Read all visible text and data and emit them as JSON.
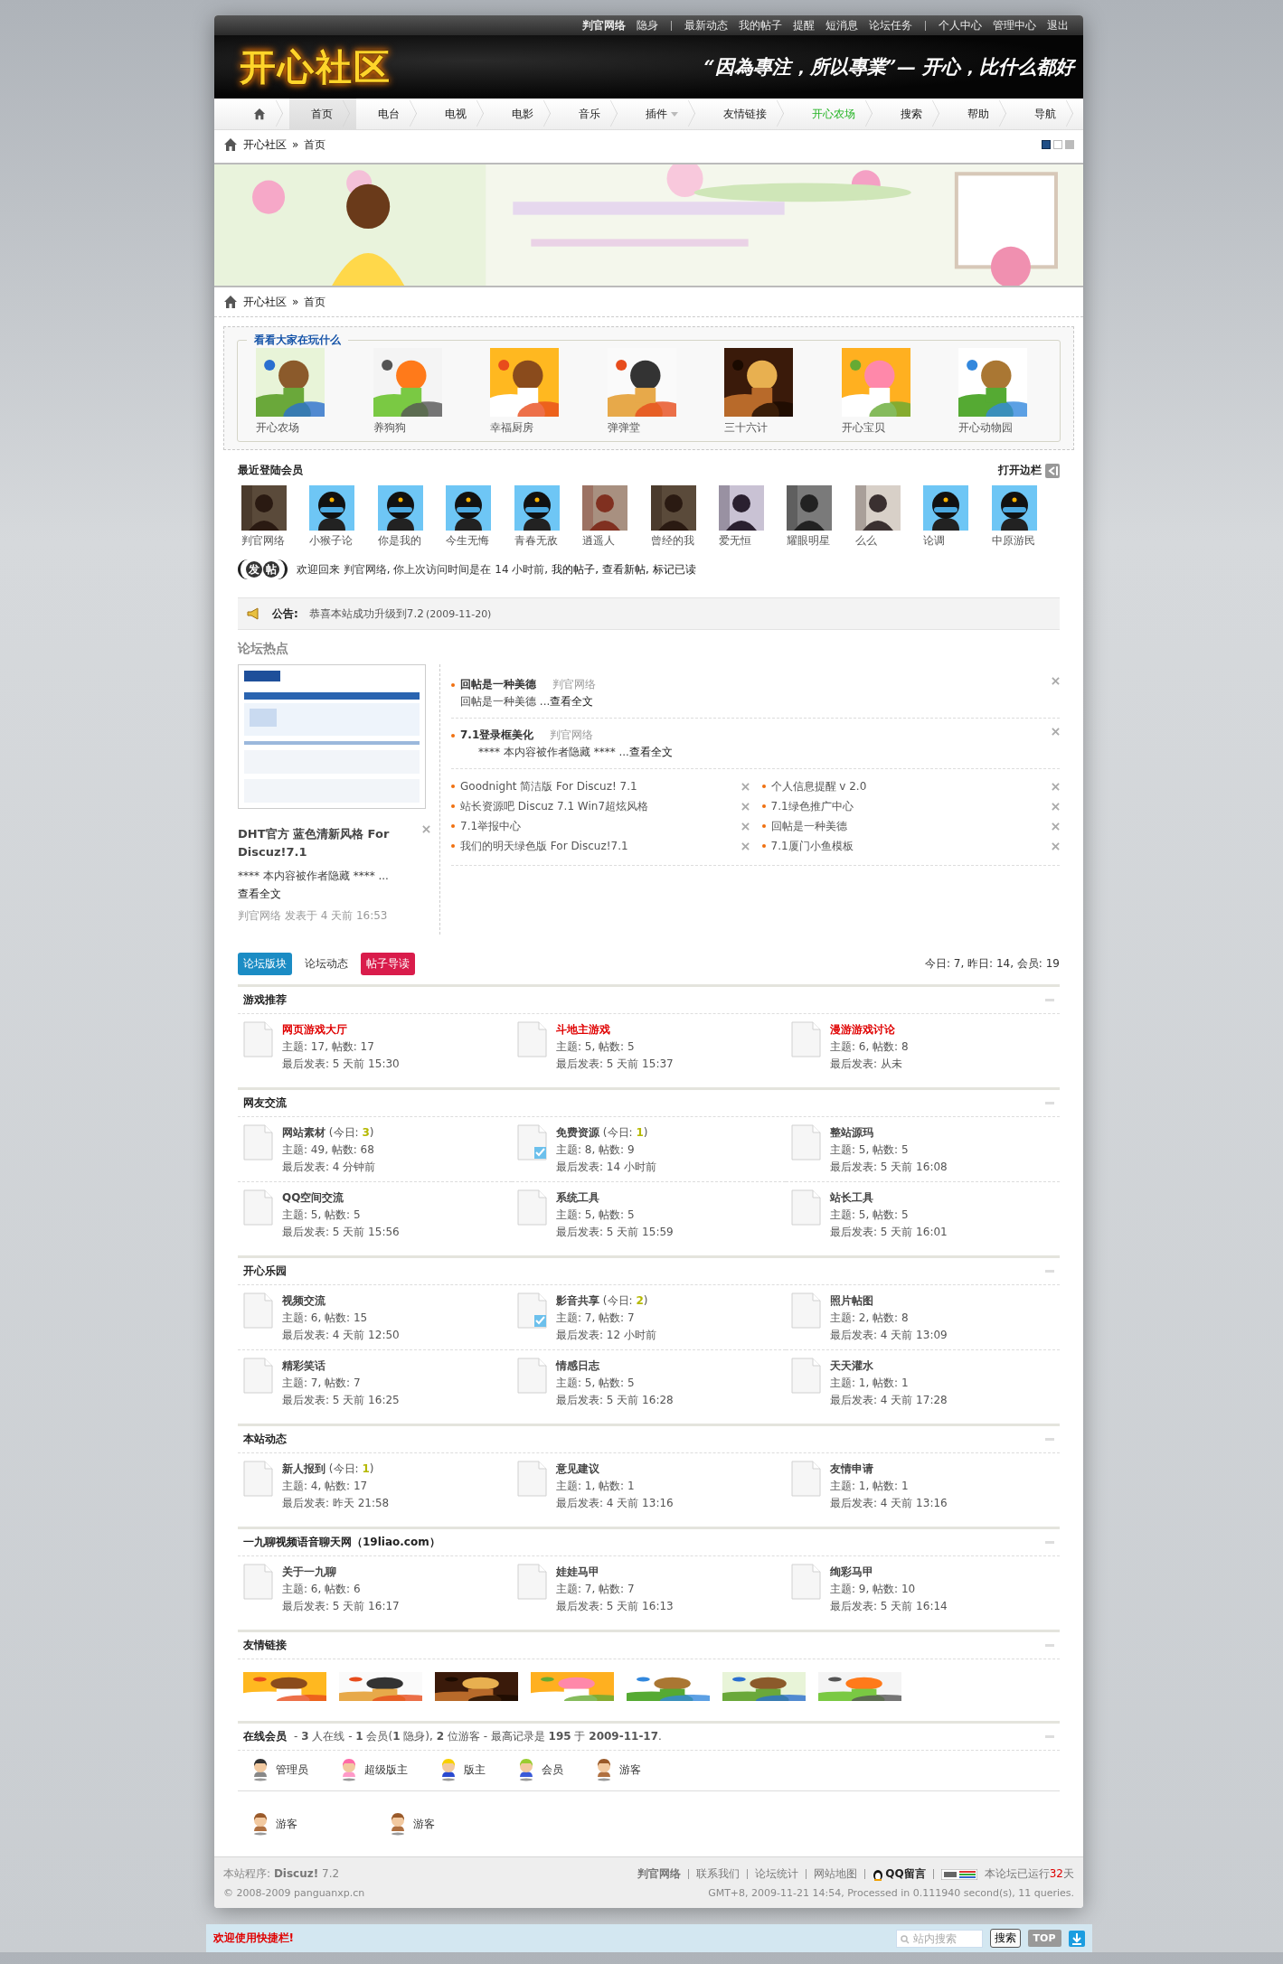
{
  "top_bar": {
    "user": "判官网络",
    "link_groups": [
      [
        "隐身"
      ],
      [
        "最新动态",
        "我的帖子",
        "提醒",
        "短消息",
        "论坛任务"
      ],
      [
        "个人中心",
        "管理中心",
        "退出"
      ]
    ]
  },
  "header": {
    "logo": "开心社区",
    "slogan": "“因為專注，所以專業”— 开心，比什么都好"
  },
  "nav": [
    {
      "label": "首页",
      "selected": true,
      "dropdown": false,
      "highlighted": false
    },
    {
      "label": "电台",
      "selected": false,
      "dropdown": false,
      "highlighted": false
    },
    {
      "label": "电视",
      "selected": false,
      "dropdown": false,
      "highlighted": false
    },
    {
      "label": "电影",
      "selected": false,
      "dropdown": false,
      "highlighted": false
    },
    {
      "label": "音乐",
      "selected": false,
      "dropdown": false,
      "highlighted": false
    },
    {
      "label": "插件",
      "selected": false,
      "dropdown": true,
      "highlighted": false
    },
    {
      "label": "友情链接",
      "selected": false,
      "dropdown": false,
      "highlighted": false
    },
    {
      "label": "开心农场",
      "selected": false,
      "dropdown": false,
      "highlighted": true
    },
    {
      "label": "搜索",
      "selected": false,
      "dropdown": false,
      "highlighted": false
    },
    {
      "label": "帮助",
      "selected": false,
      "dropdown": false,
      "highlighted": false
    },
    {
      "label": "导航",
      "selected": false,
      "dropdown": false,
      "highlighted": false
    }
  ],
  "breadcrumb": {
    "root": "开心社区",
    "separator": "»",
    "current": "首页"
  },
  "style_swatches": [
    {
      "color": "#1f4e86",
      "selected": true
    },
    {
      "color": "#ffffff",
      "selected": false
    },
    {
      "color": "#bbbbbb",
      "selected": false
    }
  ],
  "breadcrumb_2": {
    "root": "开心社区",
    "separator": "»",
    "current": "首页"
  },
  "games": {
    "title": "看看大家在玩什么",
    "items": [
      "开心农场",
      "养狗狗",
      "幸福厨房",
      "弹弹堂",
      "三十六计",
      "开心宝贝",
      "开心动物园"
    ]
  },
  "members": {
    "title": "最近登陆会员",
    "sidebar_toggle": "打开边栏",
    "items": [
      {
        "name": "判官网络"
      },
      {
        "name": "小猴子论",
        "kind": "default"
      },
      {
        "name": "你是我的",
        "kind": "default"
      },
      {
        "name": "今生无悔",
        "kind": "default"
      },
      {
        "name": "青春无敌",
        "kind": "default"
      },
      {
        "name": "逍遥人"
      },
      {
        "name": "曾经的我"
      },
      {
        "name": "爱无恒"
      },
      {
        "name": "耀眼明星"
      },
      {
        "name": "么么"
      },
      {
        "name": "论调",
        "kind": "default"
      },
      {
        "name": "中原游民",
        "kind": "default"
      }
    ]
  },
  "welcome": {
    "post_button": "发帖",
    "text": "欢迎回来  判官网络, 你上次访问时间是在  14 小时前,",
    "links": [
      "我的帖子,",
      "查看新帖,",
      "标记已读"
    ]
  },
  "announcement": {
    "label": "公告:",
    "text": "恭喜本站成功升级到7.2",
    "date": "(2009-11-20)"
  },
  "hot": {
    "title": "论坛热点",
    "feature": {
      "title": "DHT官方  蓝色清新风格  For Discuz!7.1",
      "excerpt": "**** 本内容被作者隐藏 **** ...",
      "more": "查看全文",
      "meta": "判官网络  发表于  4 天前 16:53"
    },
    "posts": [
      {
        "title": "回帖是一种美德",
        "author": "判官网络",
        "excerpt": "回帖是一种美德  ...",
        "more": "查看全文"
      },
      {
        "title": "7.1登录框美化",
        "author": "判官网络",
        "excerpt": "**** 本内容被作者隐藏 **** ...",
        "more": "查看全文"
      }
    ],
    "link_columns": [
      [
        "Goodnight 简洁版  For Discuz! 7.1",
        "站长资源吧  Discuz 7.1 Win7超炫风格",
        "7.1举报中心",
        "我们的明天绿色版  For Discuz!7.1"
      ],
      [
        "个人信息提醒  v 2.0",
        "7.1绿色推广中心",
        "回帖是一种美德",
        "7.1厦门小鱼模板"
      ]
    ]
  },
  "tabs": [
    {
      "label": "论坛版块",
      "color": "#1b8cc4"
    },
    {
      "label": "论坛动态"
    },
    {
      "label": "帖子导读",
      "color": "#d91c4b"
    }
  ],
  "stats": "今日: 7, 昨日: 14, 会员: 19",
  "sections": [
    {
      "title": "游戏推荐",
      "forums": [
        {
          "name": "网页游戏大厅",
          "highlighted": true,
          "has_new": false,
          "stats": "主题: 17, 帖数: 17",
          "last": "最后发表: 5 天前 15:30"
        },
        {
          "name": "斗地主游戏",
          "highlighted": true,
          "has_new": false,
          "stats": "主题: 5, 帖数: 5",
          "last": "最后发表: 5 天前 15:37"
        },
        {
          "name": "漫游游戏讨论",
          "highlighted": true,
          "has_new": false,
          "stats": "主题: 6, 帖数: 8",
          "last": "最后发表: 从未"
        }
      ]
    },
    {
      "title": "网友交流",
      "forums": [
        {
          "name": "网站素材",
          "highlighted": false,
          "has_new": false,
          "today": {
            "prefix": "(今日:",
            "count": "3",
            "suffix": ")"
          },
          "stats": "主题: 49, 帖数: 68",
          "last": "最后发表: 4 分钟前"
        },
        {
          "name": "免费资源",
          "highlighted": false,
          "has_new": true,
          "today": {
            "prefix": "(今日:",
            "count": "1",
            "suffix": ")"
          },
          "stats": "主题: 8, 帖数: 9",
          "last": "最后发表: 14 小时前"
        },
        {
          "name": "整站源玛",
          "highlighted": false,
          "has_new": false,
          "stats": "主题: 5, 帖数: 5",
          "last": "最后发表: 5 天前 16:08"
        },
        {
          "name": "QQ空间交流",
          "highlighted": false,
          "has_new": false,
          "stats": "主题: 5, 帖数: 5",
          "last": "最后发表: 5 天前 15:56"
        },
        {
          "name": "系统工具",
          "highlighted": false,
          "has_new": false,
          "stats": "主题: 5, 帖数: 5",
          "last": "最后发表: 5 天前 15:59"
        },
        {
          "name": "站长工具",
          "highlighted": false,
          "has_new": false,
          "stats": "主题: 5, 帖数: 5",
          "last": "最后发表: 5 天前 16:01"
        }
      ]
    },
    {
      "title": "开心乐园",
      "forums": [
        {
          "name": "视频交流",
          "highlighted": false,
          "has_new": false,
          "stats": "主题: 6, 帖数: 15",
          "last": "最后发表: 4 天前 12:50"
        },
        {
          "name": "影音共享",
          "highlighted": false,
          "has_new": true,
          "today": {
            "prefix": "(今日:",
            "count": "2",
            "suffix": ")"
          },
          "stats": "主题: 7, 帖数: 7",
          "last": "最后发表: 12 小时前"
        },
        {
          "name": "照片帖图",
          "highlighted": false,
          "has_new": false,
          "stats": "主题: 2, 帖数: 8",
          "last": "最后发表: 4 天前 13:09"
        },
        {
          "name": "精彩笑话",
          "highlighted": false,
          "has_new": false,
          "stats": "主题: 7, 帖数: 7",
          "last": "最后发表: 5 天前 16:25"
        },
        {
          "name": "情感日志",
          "highlighted": false,
          "has_new": false,
          "stats": "主题: 5, 帖数: 5",
          "last": "最后发表: 5 天前 16:28"
        },
        {
          "name": "天天灌水",
          "highlighted": false,
          "has_new": false,
          "stats": "主题: 1, 帖数: 1",
          "last": "最后发表: 4 天前 17:28"
        }
      ]
    },
    {
      "title": "本站动态",
      "forums": [
        {
          "name": "新人报到",
          "highlighted": false,
          "has_new": false,
          "today": {
            "prefix": "(今日:",
            "count": "1",
            "suffix": ")"
          },
          "stats": "主题: 4, 帖数: 17",
          "last": "最后发表: 昨天 21:58"
        },
        {
          "name": "意见建议",
          "highlighted": false,
          "has_new": false,
          "stats": "主题: 1, 帖数: 1",
          "last": "最后发表: 4 天前 13:16"
        },
        {
          "name": "友情申请",
          "highlighted": false,
          "has_new": false,
          "stats": "主题: 1, 帖数: 1",
          "last": "最后发表: 4 天前 13:16"
        }
      ]
    },
    {
      "title": "一九聊视频语音聊天网（19liao.com）",
      "forums": [
        {
          "name": "关于一九聊",
          "highlighted": false,
          "has_new": false,
          "stats": "主题: 6, 帖数: 6",
          "last": "最后发表: 5 天前 16:17"
        },
        {
          "name": "娃娃马甲",
          "highlighted": false,
          "has_new": false,
          "stats": "主题: 7, 帖数: 7",
          "last": "最后发表: 5 天前 16:13"
        },
        {
          "name": "绚彩马甲",
          "highlighted": false,
          "has_new": false,
          "stats": "主题: 9, 帖数: 10",
          "last": "最后发表: 5 天前 16:14"
        }
      ]
    }
  ],
  "friend_links": {
    "title": "友情链接"
  },
  "online": {
    "title": "在线会员",
    "summary": "- **3** 人在线 - **1** 会员(**1** 隐身), **2** 位游客 - 最高记录是 **195** 于 **2009-11-17**.",
    "legend": [
      {
        "label": "管理员",
        "kind": "admin"
      },
      {
        "label": "超级版主",
        "kind": "supermod"
      },
      {
        "label": "版主",
        "kind": "mod"
      },
      {
        "label": "会员",
        "kind": "member"
      },
      {
        "label": "游客",
        "kind": "guest"
      }
    ],
    "users": [
      {
        "name": "游客",
        "kind": "guest"
      },
      {
        "name": "游客",
        "kind": "guest"
      }
    ]
  },
  "footer": {
    "program_label": "本站程序:",
    "program": "Discuz!",
    "version": "7.2",
    "copyright": "© 2008-2009 panguanxp.cn",
    "links": [
      "判官网络",
      "联系我们",
      "论坛统计",
      "网站地图"
    ],
    "qq": "QQ留言",
    "uptime_prefix": "本论坛已运行",
    "uptime_days": "32",
    "uptime_suffix": "天",
    "processed": "GMT+8, 2009-11-21 14:54, Processed in 0.111940 second(s), 11 queries."
  },
  "quick_bar": {
    "welcome": "欢迎使用快捷栏!",
    "search_placeholder": "站内搜索",
    "search_button": "搜索",
    "top_button": "TOP"
  }
}
